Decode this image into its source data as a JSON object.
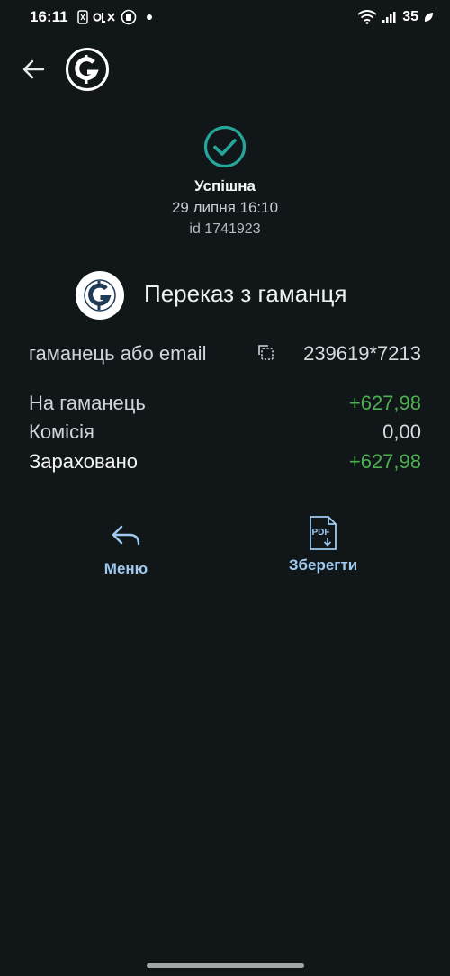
{
  "status_bar": {
    "time": "16:11",
    "battery": "35",
    "icons": [
      "nfc-icon",
      "olx-icon",
      "payment-app-icon",
      "notification-dot-icon",
      "wifi-icon",
      "signal-icon",
      "battery-leaf-icon"
    ]
  },
  "header": {
    "back_icon": "back-arrow-icon",
    "logo_icon": "gcoin-logo-icon"
  },
  "transaction": {
    "status": "Успішна",
    "date": "29 липня 16:10",
    "id": "id 1741923",
    "success_icon": "check-circle-icon"
  },
  "operation": {
    "title": "Переказ з гаманця",
    "wallet_label": "гаманець або email",
    "wallet_value": "239619*7213"
  },
  "amounts": {
    "to_wallet_label": "На гаманець",
    "to_wallet_value": "+627,98",
    "commission_label": "Комісія",
    "commission_value": "0,00",
    "credited_label": "Зараховано",
    "credited_value": "+627,98"
  },
  "actions": {
    "menu_label": "Меню",
    "save_label": "Зберегти",
    "pdf_text": "PDF"
  },
  "colors": {
    "background": "#111619",
    "accent_green": "#4caf50",
    "success_teal": "#26a69a",
    "action_blue": "#9fcbf0"
  }
}
